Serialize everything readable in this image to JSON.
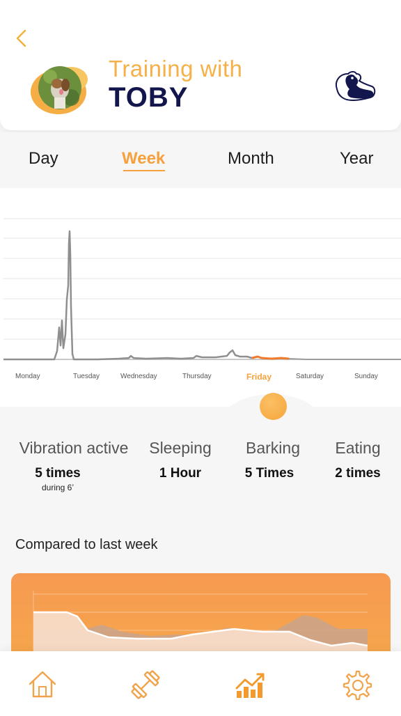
{
  "header": {
    "title_prefix": "Training with",
    "dog_name": "TOBY"
  },
  "colors": {
    "accent": "#f6a13d",
    "title_accent": "#f6b04a",
    "navy": "#13154d",
    "chart_line": "#8f8f8f",
    "chart_highlight": "#f27a2a"
  },
  "tabs": [
    {
      "label": "Day",
      "active": false
    },
    {
      "label": "Week",
      "active": true
    },
    {
      "label": "Month",
      "active": false
    },
    {
      "label": "Year",
      "active": false
    }
  ],
  "chart": {
    "days": [
      "Monday",
      "Tuesday",
      "Wednesday",
      "Thursday",
      "Friday",
      "Saturday",
      "Sunday"
    ],
    "selected_day": "Friday"
  },
  "stats": [
    {
      "label": "Vibration active",
      "value": "5 times",
      "sub": "during 6’"
    },
    {
      "label": "Sleeping",
      "value": "1 Hour"
    },
    {
      "label": "Barking",
      "value": "5 Times"
    },
    {
      "label": "Eating",
      "value": "2 times"
    }
  ],
  "comparison": {
    "title": "Compared to last week"
  },
  "nav": {
    "items": [
      "home-icon",
      "dumbbell-icon",
      "stats-icon",
      "settings-icon"
    ],
    "active": "stats-icon"
  }
}
